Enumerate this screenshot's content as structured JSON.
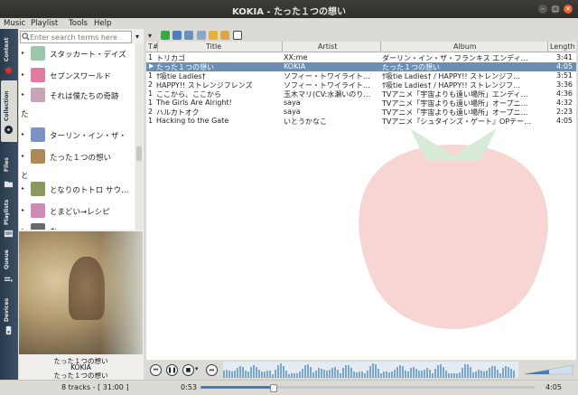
{
  "window": {
    "title": "KOKIA - たった１つの想い"
  },
  "menu": [
    "Music",
    "Playlist",
    "Tools",
    "Help"
  ],
  "tabs": [
    {
      "label": "Context",
      "icon": "strawberry-icon"
    },
    {
      "label": "Collection",
      "icon": "disc-icon"
    },
    {
      "label": "Files",
      "icon": "folder-icon"
    },
    {
      "label": "Playlists",
      "icon": "playlist-icon"
    },
    {
      "label": "Queue",
      "icon": "queue-icon"
    },
    {
      "label": "Devices",
      "icon": "device-icon"
    }
  ],
  "search": {
    "placeholder": "Enter search terms here"
  },
  "collection": [
    {
      "label": "スタッカート・デイズ",
      "color": "#9cc7a8"
    },
    {
      "label": "セブンスワールド",
      "color": "#e07aa0"
    },
    {
      "label": "それは僕たちの奇跡",
      "color": "#c9a3b8"
    },
    {
      "label": "た",
      "color": ""
    },
    {
      "label": "ターリン・イン・ザ・",
      "color": "#7a93c4"
    },
    {
      "label": "たった１つの想い",
      "color": "#b08858"
    },
    {
      "label": "と",
      "color": ""
    },
    {
      "label": "となりのトトロ サウ…",
      "color": "#8a9a5e"
    },
    {
      "label": "とまどい→レシピ",
      "color": "#d08ab8"
    },
    {
      "label": "な…",
      "color": "#6a6a6a"
    }
  ],
  "nowplaying": {
    "title": "たった１つの想い",
    "artist": "KOKIA",
    "album": "たった１つの想い"
  },
  "playlist": {
    "headers": {
      "track": "T#",
      "title": "Title",
      "artist": "Artist",
      "album": "Album",
      "length": "Length"
    },
    "rows": [
      {
        "track": "1",
        "title": "トリカゴ",
        "artist": "XX:me",
        "album": "ダーリン・イン・ザ・フランキス エンディ…",
        "length": "3:41",
        "selected": false
      },
      {
        "track": "1",
        "title": "たった１つの想い",
        "artist": "KOKIA",
        "album": "たった１つの想い",
        "length": "4:05",
        "selected": true
      },
      {
        "track": "1",
        "title": "†吸tie Ladies†",
        "artist": "ソフィー・トワイライト…",
        "album": "†吸tie Ladies† / HAPPY!! ストレンジフ…",
        "length": "3:51",
        "selected": false
      },
      {
        "track": "2",
        "title": "HAPPY!! ストレンジフレンズ",
        "artist": "ソフィー・トワイライト…",
        "album": "†吸tie Ladies† / HAPPY!! ストレンジフ…",
        "length": "3:36",
        "selected": false
      },
      {
        "track": "1",
        "title": "ここから、ここから",
        "artist": "玉木マリ(CV:水瀬いのり…",
        "album": "TVアニメ「宇宙よりも遠い場所」エンディ…",
        "length": "4:36",
        "selected": false
      },
      {
        "track": "1",
        "title": "The Girls Are Alright!",
        "artist": "saya",
        "album": "TVアニメ「宇宙よりも遠い場所」オープニ…",
        "length": "4:32",
        "selected": false
      },
      {
        "track": "2",
        "title": "ハルカトオク",
        "artist": "saya",
        "album": "TVアニメ「宇宙よりも遠い場所」オープニ…",
        "length": "2:23",
        "selected": false
      },
      {
        "track": "1",
        "title": "Hacking to the Gate",
        "artist": "いとうかなこ",
        "album": "TVアニメ『シュタインズ・ゲート』OPテー…",
        "length": "4:05",
        "selected": false
      }
    ]
  },
  "status": {
    "tracks": "8 tracks - [ 31:00 ]",
    "elapsed": "0:53",
    "total": "4:05",
    "progress": 0.216
  },
  "colors": {
    "accent": "#3d7fc1",
    "selection": "#6b8fb3",
    "tabstrip": "#2f4358"
  }
}
